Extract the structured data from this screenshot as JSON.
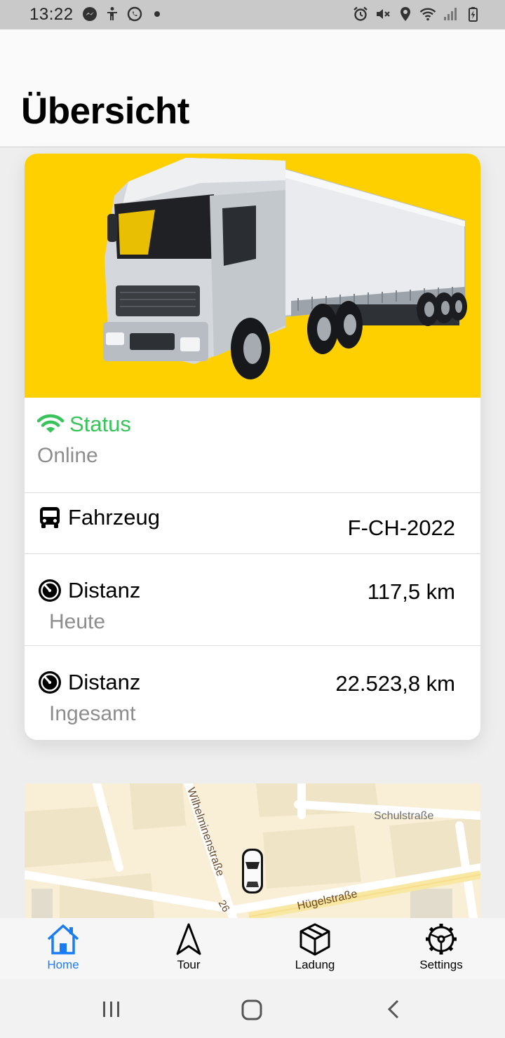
{
  "status_bar": {
    "time": "13:22",
    "left_icons": [
      "messenger-icon",
      "accessibility-icon",
      "whatsapp-icon",
      "dot-icon"
    ],
    "right_icons": [
      "alarm-icon",
      "mute-icon",
      "location-icon",
      "wifi-icon",
      "signal-icon",
      "battery-icon"
    ]
  },
  "header": {
    "title": "Übersicht"
  },
  "vehicle_card": {
    "image": "truck-photo",
    "image_background": "#ffd000",
    "status": {
      "label": "Status",
      "value": "Online",
      "color": "#38c45a",
      "icon": "wifi-icon"
    },
    "rows": [
      {
        "icon": "bus-icon",
        "label": "Fahrzeug",
        "value": "F-CH-2022",
        "sub": ""
      },
      {
        "icon": "timer-icon",
        "label": "Distanz",
        "value": "117,5 km",
        "sub": "Heute"
      },
      {
        "icon": "timer-icon",
        "label": "Distanz",
        "value": "22.523,8 km",
        "sub": "Ingesamt"
      }
    ]
  },
  "map": {
    "streets": [
      "Wilhelminenstraße",
      "Schulstraße",
      "Hügelstraße"
    ],
    "route_number": "26",
    "vehicle_marker": "car-icon"
  },
  "tabbar": {
    "active_color": "#1a7cf5",
    "tabs": [
      {
        "label": "Home",
        "icon": "home-icon",
        "active": true
      },
      {
        "label": "Tour",
        "icon": "navigation-icon",
        "active": false
      },
      {
        "label": "Ladung",
        "icon": "package-icon",
        "active": false
      },
      {
        "label": "Settings",
        "icon": "settings-icon",
        "active": false
      }
    ]
  },
  "system_nav": {
    "buttons": [
      "recent-apps-icon",
      "home-button-icon",
      "back-icon"
    ]
  }
}
